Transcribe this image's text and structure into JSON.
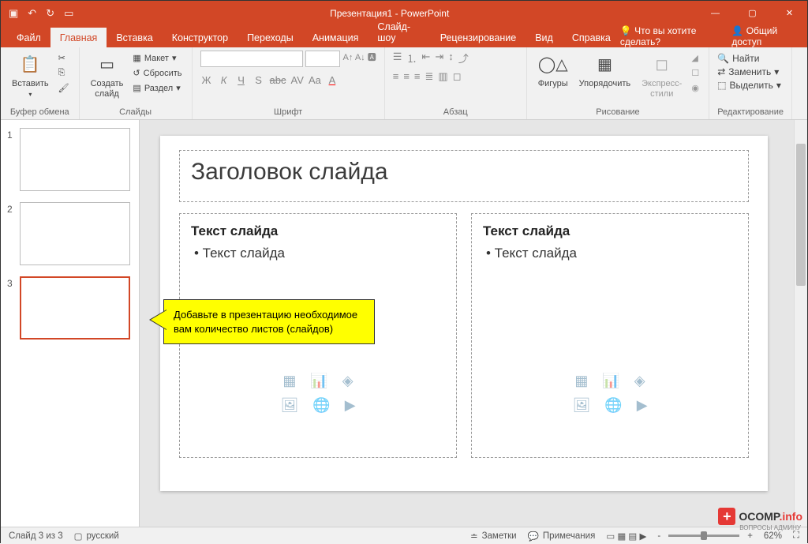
{
  "title": "Презентация1  -  PowerPoint",
  "tabs": [
    "Файл",
    "Главная",
    "Вставка",
    "Конструктор",
    "Переходы",
    "Анимация",
    "Слайд-шоу",
    "Рецензирование",
    "Вид",
    "Справка"
  ],
  "tellme": "Что вы хотите сделать?",
  "share": "Общий доступ",
  "ribbon": {
    "clipboard": {
      "paste": "Вставить",
      "label": "Буфер обмена"
    },
    "slides": {
      "new": "Создать\nслайд",
      "layout": "Макет",
      "reset": "Сбросить",
      "section": "Раздел",
      "label": "Слайды"
    },
    "font": {
      "label": "Шрифт"
    },
    "paragraph": {
      "label": "Абзац"
    },
    "drawing": {
      "shapes": "Фигуры",
      "arrange": "Упорядочить",
      "quick": "Экспресс-\nстили",
      "label": "Рисование"
    },
    "editing": {
      "find": "Найти",
      "replace": "Заменить",
      "select": "Выделить",
      "label": "Редактирование"
    }
  },
  "thumbs": [
    "1",
    "2",
    "3"
  ],
  "slide": {
    "title": "Заголовок слайда",
    "header": "Текст слайда",
    "bullet": "• Текст слайда"
  },
  "callout": "Добавьте в презентацию необходимое вам количество листов (слайдов)",
  "status": {
    "slide": "Слайд 3 из 3",
    "lang": "русский",
    "notes": "Заметки",
    "comments": "Примечания",
    "zoom": "62%"
  },
  "watermark": {
    "brand": "OCOMP",
    "tld": ".info",
    "sub": "ВОПРОСЫ АДМИНУ"
  }
}
